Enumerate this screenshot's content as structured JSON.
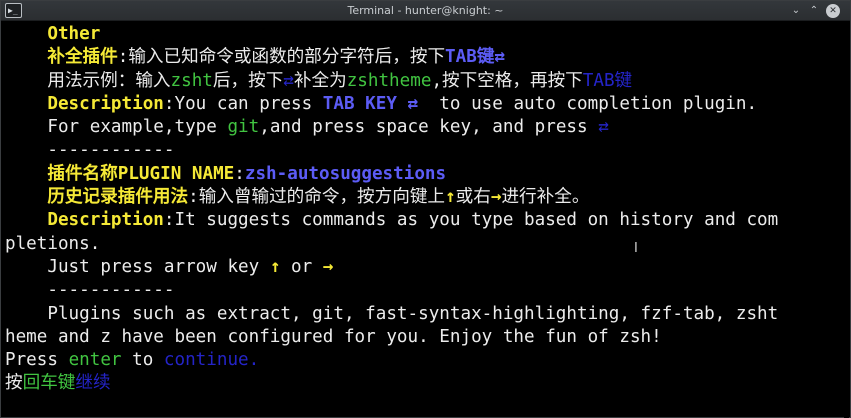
{
  "window": {
    "title": "Terminal - hunter@knight: ~",
    "app_icon_glyph": "▶_",
    "minimize_glyph": "⌄",
    "maximize_glyph": "⌃",
    "close_glyph": "✕"
  },
  "colors": {
    "background": "#000000",
    "yellow": "#f5e936",
    "green": "#41c441",
    "blue": "#2424c8",
    "bright_blue": "#5c5cf5",
    "text": "#e5e5e5"
  },
  "lines": [
    [
      {
        "t": "    Other",
        "c": "y"
      }
    ],
    [
      {
        "t": "    补全插件",
        "c": "y"
      },
      {
        "t": ":输入已知命令或函数的部分字符后，按下",
        "c": "w"
      },
      {
        "t": "TAB键",
        "c": "bb"
      },
      {
        "t": "⇄",
        "c": "bb"
      }
    ],
    [
      {
        "t": "    用法示例：输入",
        "c": "w"
      },
      {
        "t": "zsht",
        "c": "g"
      },
      {
        "t": "后，按下",
        "c": "w"
      },
      {
        "t": "⇄",
        "c": "b"
      },
      {
        "t": "补全为",
        "c": "w"
      },
      {
        "t": "zshtheme",
        "c": "g"
      },
      {
        "t": ",按下空格，再按下",
        "c": "w"
      },
      {
        "t": "TAB键",
        "c": "b"
      }
    ],
    [
      {
        "t": "    Description",
        "c": "y"
      },
      {
        "t": ":You can press ",
        "c": "w"
      },
      {
        "t": "TAB KEY ⇄",
        "c": "bb"
      },
      {
        "t": "  to use auto completion plugin.",
        "c": "w"
      }
    ],
    [
      {
        "t": "    For example,type ",
        "c": "w"
      },
      {
        "t": "git",
        "c": "g"
      },
      {
        "t": ",and press space key, and press ",
        "c": "w"
      },
      {
        "t": "⇄",
        "c": "b"
      }
    ],
    [
      {
        "t": "    ------------",
        "c": "w"
      }
    ],
    [
      {
        "t": "    插件名称PLUGIN NAME",
        "c": "y"
      },
      {
        "t": ":",
        "c": "w"
      },
      {
        "t": "zsh-autosuggestions",
        "c": "bb"
      }
    ],
    [
      {
        "t": "    历史记录插件用法",
        "c": "y"
      },
      {
        "t": ":输入曾输过的命令，按方向键上",
        "c": "w"
      },
      {
        "t": "↑",
        "c": "y"
      },
      {
        "t": "或右",
        "c": "w"
      },
      {
        "t": "→",
        "c": "y"
      },
      {
        "t": "进行补全。",
        "c": "w"
      }
    ],
    [
      {
        "t": "    Description",
        "c": "y"
      },
      {
        "t": ":It suggests commands as you type based on history and com",
        "c": "w"
      }
    ],
    [
      {
        "t": "pletions.",
        "c": "w"
      }
    ],
    [
      {
        "t": "    Just press arrow key ",
        "c": "w"
      },
      {
        "t": "↑",
        "c": "y"
      },
      {
        "t": " or ",
        "c": "w"
      },
      {
        "t": "→",
        "c": "y"
      }
    ],
    [
      {
        "t": "    ------------",
        "c": "w"
      }
    ],
    [
      {
        "t": "    Plugins such as extract, git, fast-syntax-highlighting, fzf-tab, zsht",
        "c": "w"
      }
    ],
    [
      {
        "t": "heme and z have been configured for you. Enjoy the fun of zsh!",
        "c": "w"
      }
    ],
    [
      {
        "t": "Press ",
        "c": "w"
      },
      {
        "t": "enter",
        "c": "g"
      },
      {
        "t": " to ",
        "c": "w"
      },
      {
        "t": "continue.",
        "c": "b"
      }
    ],
    [
      {
        "t": "按",
        "c": "w"
      },
      {
        "t": "回车键",
        "c": "g"
      },
      {
        "t": "继续",
        "c": "b"
      }
    ]
  ],
  "mouse_pointer_glyph": "I"
}
